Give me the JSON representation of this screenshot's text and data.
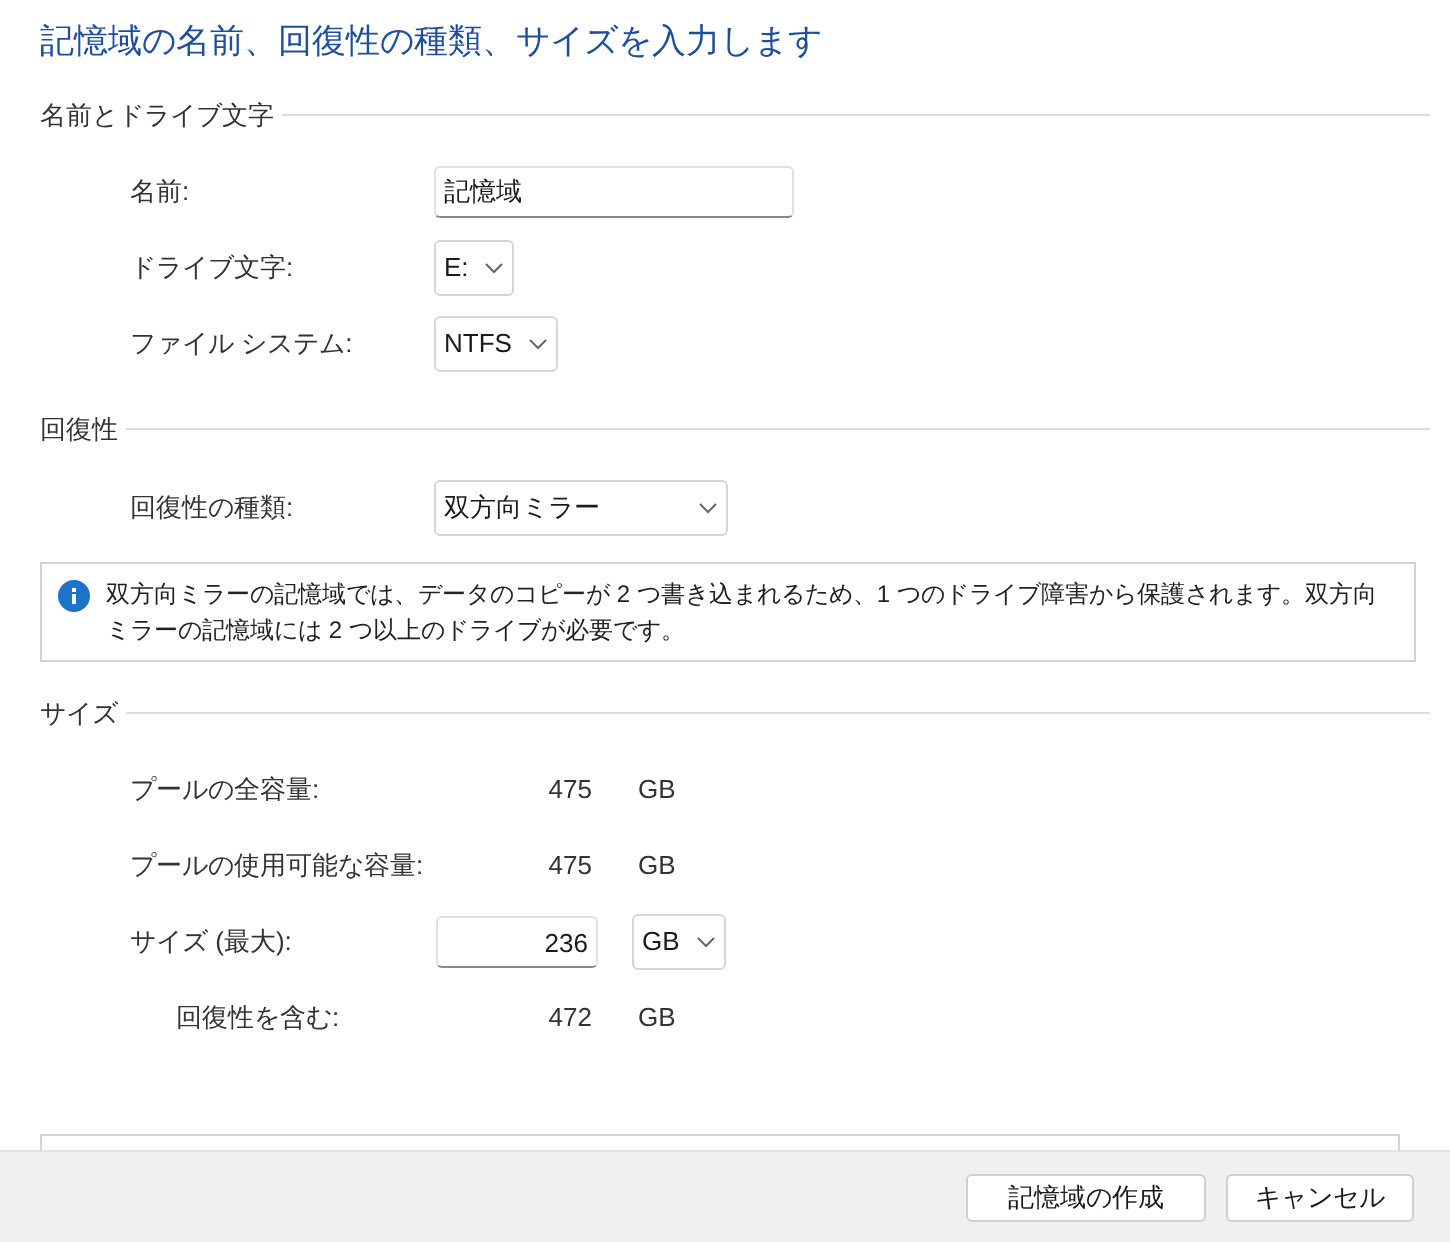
{
  "heading": "記憶域の名前、回復性の種類、サイズを入力します",
  "sections": [
    {
      "title": "名前とドライブ文字",
      "rows": [
        {
          "kind": "text",
          "label": "名前:",
          "value": "記憶域"
        },
        {
          "kind": "select",
          "label": "ドライブ文字:",
          "value": "E:"
        },
        {
          "kind": "select",
          "label": "ファイル システム:",
          "value": "NTFS"
        }
      ]
    },
    {
      "title": "回復性",
      "rows": [
        {
          "kind": "wideselect",
          "label": "回復性の種類:",
          "value": "双方向ミラー"
        }
      ],
      "info": "双方向ミラーの記憶域では、データのコピーが 2 つ書き込まれるため、1 つのドライブ障害から保護されます。双方向ミラーの記憶域には 2 つ以上のドライブが必要です。"
    },
    {
      "title": "サイズ",
      "rows": [
        {
          "kind": "readout",
          "label": "プールの全容量:",
          "value": "475",
          "unit": "GB"
        },
        {
          "kind": "readout",
          "label": "プールの使用可能な容量:",
          "value": "475",
          "unit": "GB"
        },
        {
          "kind": "size",
          "label": "サイズ (最大):",
          "value": "236",
          "unit": "GB"
        },
        {
          "kind": "readout",
          "label": "回復性を含む:",
          "value": "472",
          "unit": "GB",
          "indented": true
        }
      ]
    }
  ],
  "buttons": [
    "記憶域の作成",
    "キャンセル"
  ]
}
